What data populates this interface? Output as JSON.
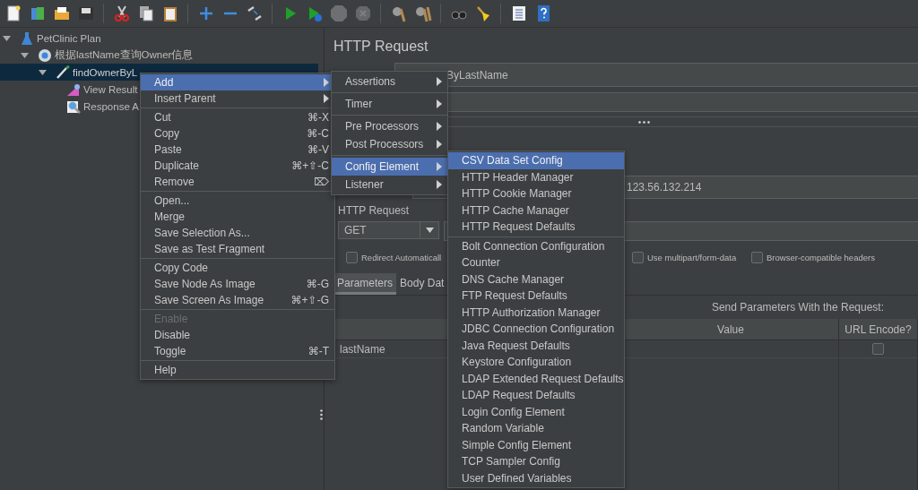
{
  "toolbar": [
    {
      "kind": "new",
      "disabled": false
    },
    {
      "kind": "templates",
      "disabled": false
    },
    {
      "kind": "open",
      "disabled": false
    },
    {
      "kind": "save",
      "disabled": false
    },
    {
      "kind": "separator"
    },
    {
      "kind": "cut",
      "disabled": false
    },
    {
      "kind": "copy",
      "disabled": false
    },
    {
      "kind": "paste",
      "disabled": false
    },
    {
      "kind": "separator"
    },
    {
      "kind": "expand",
      "disabled": false
    },
    {
      "kind": "collapse",
      "disabled": false
    },
    {
      "kind": "toggle",
      "disabled": false
    },
    {
      "kind": "separator"
    },
    {
      "kind": "start",
      "disabled": false
    },
    {
      "kind": "start-no-pause",
      "disabled": false
    },
    {
      "kind": "stop",
      "disabled": true
    },
    {
      "kind": "shutdown",
      "disabled": true
    },
    {
      "kind": "separator"
    },
    {
      "kind": "clear",
      "disabled": false
    },
    {
      "kind": "clear-all",
      "disabled": false
    },
    {
      "kind": "separator"
    },
    {
      "kind": "search",
      "disabled": false
    },
    {
      "kind": "reset-search",
      "disabled": false
    },
    {
      "kind": "separator"
    },
    {
      "kind": "function-helper",
      "disabled": false
    },
    {
      "kind": "help",
      "disabled": false
    }
  ],
  "tree": [
    {
      "label": "PetClinic Plan",
      "kind": "plan",
      "expanded": true,
      "selected": false,
      "children": [
        {
          "label": "根据lastName查询Owner信息",
          "kind": "thread-group",
          "expanded": true,
          "selected": false,
          "children": [
            {
              "label": "findOwnerByL",
              "kind": "sampler",
              "expanded": true,
              "selected": true,
              "children": [
                {
                  "label": "View Result",
                  "kind": "listener",
                  "selected": false
                },
                {
                  "label": "Response A",
                  "kind": "assertion",
                  "selected": false
                }
              ]
            }
          ]
        }
      ]
    }
  ],
  "context_menu": [
    {
      "kind": "item",
      "label": "Add",
      "submenu": true,
      "selected": true,
      "disabled": false
    },
    {
      "kind": "item",
      "label": "Insert Parent",
      "submenu": true,
      "selected": false,
      "disabled": false
    },
    {
      "kind": "separator"
    },
    {
      "kind": "item",
      "label": "Cut",
      "shortcut": "⌘-X",
      "selected": false,
      "disabled": false
    },
    {
      "kind": "item",
      "label": "Copy",
      "shortcut": "⌘-C",
      "selected": false,
      "disabled": false
    },
    {
      "kind": "item",
      "label": "Paste",
      "shortcut": "⌘-V",
      "selected": false,
      "disabled": false
    },
    {
      "kind": "item",
      "label": "Duplicate",
      "shortcut": "⌘+⇧-C",
      "selected": false,
      "disabled": false
    },
    {
      "kind": "item",
      "label": "Remove",
      "shortcut": "⌦",
      "selected": false,
      "disabled": false
    },
    {
      "kind": "separator"
    },
    {
      "kind": "item",
      "label": "Open...",
      "selected": false,
      "disabled": false
    },
    {
      "kind": "item",
      "label": "Merge",
      "selected": false,
      "disabled": false
    },
    {
      "kind": "item",
      "label": "Save Selection As...",
      "selected": false,
      "disabled": false
    },
    {
      "kind": "item",
      "label": "Save as Test Fragment",
      "selected": false,
      "disabled": false
    },
    {
      "kind": "separator"
    },
    {
      "kind": "item",
      "label": "Copy Code",
      "selected": false,
      "disabled": false
    },
    {
      "kind": "item",
      "label": "Save Node As Image",
      "shortcut": "⌘-G",
      "selected": false,
      "disabled": false
    },
    {
      "kind": "item",
      "label": "Save Screen As Image",
      "shortcut": "⌘+⇧-G",
      "selected": false,
      "disabled": false
    },
    {
      "kind": "separator"
    },
    {
      "kind": "item",
      "label": "Enable",
      "selected": false,
      "disabled": true
    },
    {
      "kind": "item",
      "label": "Disable",
      "selected": false,
      "disabled": false
    },
    {
      "kind": "item",
      "label": "Toggle",
      "shortcut": "⌘-T",
      "selected": false,
      "disabled": false
    },
    {
      "kind": "separator"
    },
    {
      "kind": "item",
      "label": "Help",
      "selected": false,
      "disabled": false
    }
  ],
  "add_menu": [
    {
      "kind": "item",
      "label": "Assertions",
      "submenu": true,
      "selected": false,
      "disabled": false
    },
    {
      "kind": "separator"
    },
    {
      "kind": "item",
      "label": "Timer",
      "submenu": true,
      "selected": false,
      "disabled": false
    },
    {
      "kind": "separator"
    },
    {
      "kind": "item",
      "label": "Pre Processors",
      "submenu": true,
      "selected": false,
      "disabled": false
    },
    {
      "kind": "item",
      "label": "Post Processors",
      "submenu": true,
      "selected": false,
      "disabled": false
    },
    {
      "kind": "separator"
    },
    {
      "kind": "item",
      "label": "Config Element",
      "submenu": true,
      "selected": true,
      "disabled": false
    },
    {
      "kind": "item",
      "label": "Listener",
      "submenu": true,
      "selected": false,
      "disabled": false
    }
  ],
  "config_menu": [
    {
      "kind": "item",
      "label": "CSV Data Set Config",
      "selected": true,
      "disabled": false
    },
    {
      "kind": "item",
      "label": "HTTP Header Manager",
      "selected": false,
      "disabled": false
    },
    {
      "kind": "item",
      "label": "HTTP Cookie Manager",
      "selected": false,
      "disabled": false
    },
    {
      "kind": "item",
      "label": "HTTP Cache Manager",
      "selected": false,
      "disabled": false
    },
    {
      "kind": "item",
      "label": "HTTP Request Defaults",
      "selected": false,
      "disabled": false
    },
    {
      "kind": "separator"
    },
    {
      "kind": "item",
      "label": "Bolt Connection Configuration",
      "selected": false,
      "disabled": false
    },
    {
      "kind": "item",
      "label": "Counter",
      "selected": false,
      "disabled": false
    },
    {
      "kind": "item",
      "label": "DNS Cache Manager",
      "selected": false,
      "disabled": false
    },
    {
      "kind": "item",
      "label": "FTP Request Defaults",
      "selected": false,
      "disabled": false
    },
    {
      "kind": "item",
      "label": "HTTP Authorization Manager",
      "selected": false,
      "disabled": false
    },
    {
      "kind": "item",
      "label": "JDBC Connection Configuration",
      "selected": false,
      "disabled": false
    },
    {
      "kind": "item",
      "label": "Java Request Defaults",
      "selected": false,
      "disabled": false
    },
    {
      "kind": "item",
      "label": "Keystore Configuration",
      "selected": false,
      "disabled": false
    },
    {
      "kind": "item",
      "label": "LDAP Extended Request Defaults",
      "selected": false,
      "disabled": false
    },
    {
      "kind": "item",
      "label": "LDAP Request Defaults",
      "selected": false,
      "disabled": false
    },
    {
      "kind": "item",
      "label": "Login Config Element",
      "selected": false,
      "disabled": false
    },
    {
      "kind": "item",
      "label": "Random Variable",
      "selected": false,
      "disabled": false
    },
    {
      "kind": "item",
      "label": "Simple Config Element",
      "selected": false,
      "disabled": false
    },
    {
      "kind": "item",
      "label": "TCP Sampler Config",
      "selected": false,
      "disabled": false
    },
    {
      "kind": "item",
      "label": "User Defined Variables",
      "selected": false,
      "disabled": false
    }
  ],
  "editor": {
    "title": "HTTP Request",
    "name_value": "ByLastName",
    "server_value": "123.56.132.214",
    "method_group": "HTTP Request",
    "method": "GET",
    "options": [
      {
        "label": "Redirect Automaticall",
        "checked": false
      },
      {
        "label": "Use multipart/form-data",
        "checked": false
      },
      {
        "label": "Browser-compatible headers",
        "checked": false
      }
    ],
    "tabs": [
      {
        "label": "Parameters",
        "selected": true
      },
      {
        "label": "Body Dat",
        "selected": false
      }
    ],
    "table": {
      "caption": "Send Parameters With the Request:",
      "columns": [
        "Value",
        "URL Encode?"
      ],
      "rows": [
        {
          "name": "lastName",
          "url_encode": false
        }
      ]
    }
  }
}
